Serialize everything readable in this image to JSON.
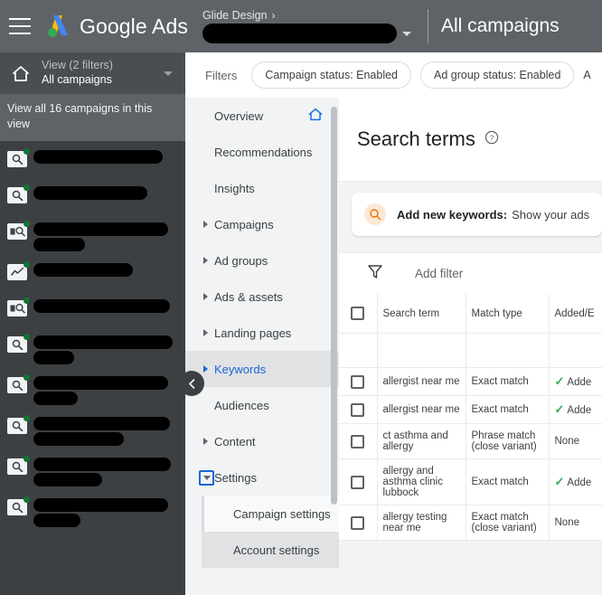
{
  "topbar": {
    "menu_icon": "hamburger-menu-icon",
    "logo_icon": "google-ads-logo-icon",
    "brand_google": "Google",
    "brand_ads": "Ads",
    "account_breadcrumb": "Glide Design",
    "breadcrumb_chevron": "›",
    "account_name_redacted": "",
    "account_dropdown_icon": "caret-down-icon",
    "page_scope_title": "All campaigns"
  },
  "leftbar": {
    "home_icon": "home-icon",
    "view_label": "View (2 filters)",
    "view_value": "All campaigns",
    "view_caret_icon": "caret-down-icon",
    "view_all_text": "View all 16 campaigns in this view",
    "campaigns": [
      {
        "icon": "search-campaign-icon",
        "status": "enabled",
        "lines": [
          88
        ]
      },
      {
        "icon": "search-campaign-icon",
        "status": "enabled",
        "lines": [
          78
        ]
      },
      {
        "icon": "display-search-campaign-icon",
        "status": "enabled",
        "lines": [
          92,
          35
        ]
      },
      {
        "icon": "performance-max-icon",
        "status": "enabled",
        "lines": [
          68
        ]
      },
      {
        "icon": "display-search-campaign-icon",
        "status": "enabled",
        "lines": [
          93
        ]
      },
      {
        "icon": "search-campaign-icon",
        "status": "enabled",
        "lines": [
          95,
          28
        ]
      },
      {
        "icon": "search-campaign-icon",
        "status": "enabled",
        "lines": [
          92,
          30
        ]
      },
      {
        "icon": "search-campaign-icon",
        "status": "enabled",
        "lines": [
          93,
          62
        ]
      },
      {
        "icon": "search-campaign-icon",
        "status": "enabled",
        "lines": [
          94,
          47
        ]
      },
      {
        "icon": "search-campaign-icon",
        "status": "enabled",
        "lines": [
          92,
          32
        ]
      }
    ]
  },
  "filterbar": {
    "label": "Filters",
    "chips": [
      "Campaign status: Enabled",
      "Ad group status: Enabled",
      "A"
    ]
  },
  "nav": {
    "scrollbar_icon": "vertical-scrollbar",
    "collapse_icon": "chevron-left-icon",
    "items": [
      {
        "label": "Overview",
        "arrow": false,
        "selected": false,
        "trailing_icon": "home-blue-icon"
      },
      {
        "label": "Recommendations",
        "arrow": false,
        "selected": false
      },
      {
        "label": "Insights",
        "arrow": false,
        "selected": false
      },
      {
        "label": "Campaigns",
        "arrow": true,
        "selected": false
      },
      {
        "label": "Ad groups",
        "arrow": true,
        "selected": false
      },
      {
        "label": "Ads & assets",
        "arrow": true,
        "selected": false
      },
      {
        "label": "Landing pages",
        "arrow": true,
        "selected": false
      },
      {
        "label": "Keywords",
        "arrow": true,
        "selected": true
      },
      {
        "label": "Audiences",
        "arrow": false,
        "selected": false
      },
      {
        "label": "Content",
        "arrow": true,
        "selected": false
      }
    ],
    "settings": {
      "label": "Settings",
      "expanded": true,
      "toggle_icon": "caret-down-icon",
      "children": [
        {
          "label": "Campaign settings",
          "active": false
        },
        {
          "label": "Account settings",
          "active": true
        }
      ]
    }
  },
  "main": {
    "page_title": "Search terms",
    "help_icon": "help-circle-icon",
    "banner": {
      "icon": "search-keyword-icon",
      "bold_text": "Add new keywords:",
      "rest_text": "Show your ads"
    },
    "filter": {
      "icon": "filter-funnel-icon",
      "label": "Add filter"
    },
    "table": {
      "columns": [
        "Search term",
        "Match type",
        "Added/E"
      ],
      "select_all_icon": "checkbox-icon",
      "rows": [
        {
          "term": "allergist near me",
          "match": "Exact match",
          "added": "Adde",
          "added_check": true
        },
        {
          "term": "allergist near me",
          "match": "Exact match",
          "added": "Adde",
          "added_check": true
        },
        {
          "term": "ct asthma and allergy",
          "match": "Phrase match (close variant)",
          "added": "None",
          "added_check": false
        },
        {
          "term": "allergy and asthma clinic lubbock",
          "match": "Exact match",
          "added": "Adde",
          "added_check": true
        },
        {
          "term": "allergy testing near me",
          "match": "Exact match (close variant)",
          "added": "None",
          "added_check": false
        }
      ]
    }
  },
  "colors": {
    "topbar_bg": "#5f6368",
    "sidebar_bg": "#3c4043",
    "nav_bg": "#f1f3f4",
    "accent_blue": "#1967d2",
    "status_green": "#137333",
    "check_green": "#34a853",
    "banner_icon_bg": "#fce8d5"
  }
}
